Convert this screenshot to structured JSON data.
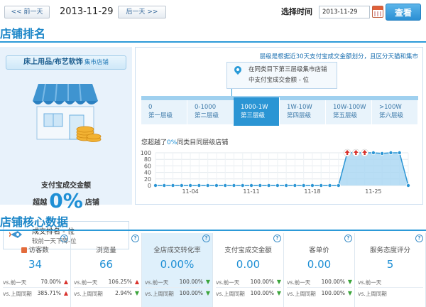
{
  "toolbar": {
    "prev_label": "<< 前一天",
    "current_date": "2013-11-29",
    "next_label": "后一天 >>",
    "select_time_label": "选择时间",
    "date_value": "2013-11-29",
    "query_label": "查看"
  },
  "ranking_section": {
    "title": "店铺排名",
    "store_name": "床上用品/布艺软饰",
    "store_type": "集市店铺",
    "pay_amount_label": "支付宝成交金额",
    "beyond_prefix": "超越",
    "beyond_percent": "0%",
    "beyond_suffix": "店铺",
    "deal_rank_label": "成交排名 - 位",
    "deal_rank_change": "较前一天下降-位"
  },
  "tier_panel": {
    "note": "层级是根据近30天支付宝成交金额划分，且区分天猫和集市",
    "tip_line1": "在同类目下第三层级集市店铺",
    "tip_line2": "中支付宝成交金额 - 位",
    "tiers": [
      {
        "range": "0",
        "name": "第一层级"
      },
      {
        "range": "0-1000",
        "name": "第二层级"
      },
      {
        "range": "1000-1W",
        "name": "第三层级"
      },
      {
        "range": "1W-10W",
        "name": "第四层级"
      },
      {
        "range": "10W-100W",
        "name": "第五层级"
      },
      {
        "range": ">100W",
        "name": "第六层级"
      }
    ],
    "active_tier_index": 2,
    "chart_caption_prefix": "您超越了",
    "chart_caption_value": "0%",
    "chart_caption_suffix": "同类目同层级店铺"
  },
  "chart_data": {
    "type": "area",
    "title": "",
    "xlabel": "",
    "ylabel": "",
    "ylim": [
      0,
      100
    ],
    "yticks": [
      0,
      20,
      40,
      60,
      80,
      100
    ],
    "xticks": [
      "11-04",
      "11-11",
      "11-18",
      "11-25"
    ],
    "xtick_indices": [
      4,
      11,
      18,
      25
    ],
    "grid": true,
    "color": "#2b95d4",
    "values": [
      0,
      0,
      0,
      0,
      0,
      0,
      0,
      0,
      0,
      0,
      0,
      0,
      0,
      0,
      0,
      0,
      0,
      0,
      0,
      0,
      0,
      0,
      100,
      100,
      100,
      100,
      98,
      100,
      100,
      0
    ],
    "up_arrow_indices": [
      22,
      23,
      24
    ]
  },
  "core_section": {
    "title": "店铺核心数据",
    "metrics": [
      {
        "label": "访客数",
        "value": "34",
        "row1_label": "vs.前一天",
        "row1_value": "70.00%",
        "row1_dir": "up",
        "row2_label": "vs.上周同期",
        "row2_value": "385.71%",
        "row2_dir": "up",
        "highlight": false
      },
      {
        "label": "浏览量",
        "value": "66",
        "row1_label": "vs.前一天",
        "row1_value": "106.25%",
        "row1_dir": "up",
        "row2_label": "vs.上周同期",
        "row2_value": "2.94%",
        "row2_dir": "down",
        "highlight": false
      },
      {
        "label": "全店成交转化率",
        "value": "0.00%",
        "row1_label": "vs.前一天",
        "row1_value": "100.00%",
        "row1_dir": "down",
        "row2_label": "vs.上周同期",
        "row2_value": "100.00%",
        "row2_dir": "down",
        "highlight": true
      },
      {
        "label": "支付宝成交金额",
        "value": "0.00",
        "row1_label": "vs.前一天",
        "row1_value": "100.00%",
        "row1_dir": "down",
        "row2_label": "vs.上周同期",
        "row2_value": "100.00%",
        "row2_dir": "down",
        "highlight": false
      },
      {
        "label": "客单价",
        "value": "0.00",
        "row1_label": "vs.前一天",
        "row1_value": "100.00%",
        "row1_dir": "down",
        "row2_label": "vs.上周同期",
        "row2_value": "100.00%",
        "row2_dir": "down",
        "highlight": false
      },
      {
        "label": "服务态度评分",
        "value": "5",
        "row1_label": "vs.前一天",
        "row1_value": "",
        "row1_dir": "",
        "row2_label": "vs.上周同期",
        "row2_value": "",
        "row2_dir": "",
        "highlight": false
      }
    ]
  }
}
